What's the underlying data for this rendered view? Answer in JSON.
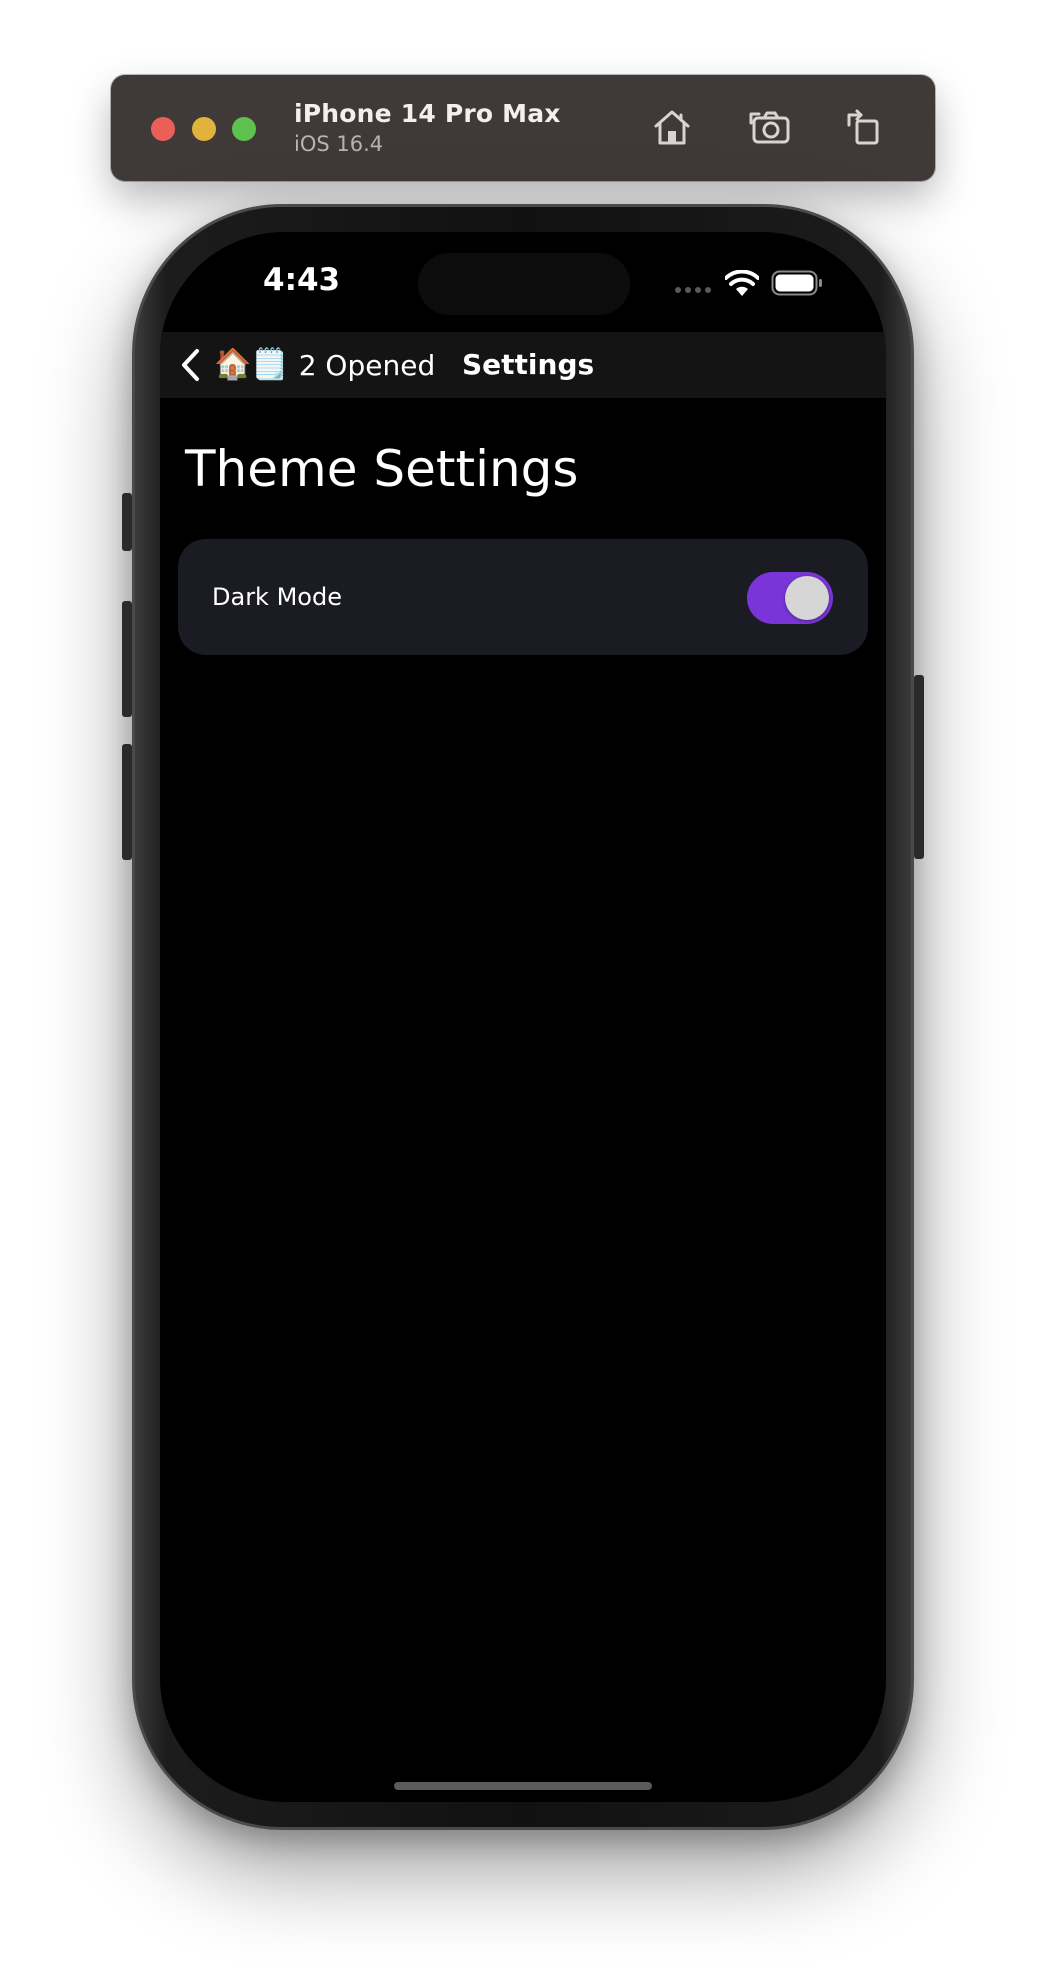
{
  "simulator": {
    "device_name": "iPhone 14 Pro Max",
    "os_version": "iOS 16.4",
    "toolbar_icons": [
      "home-icon",
      "screenshot-camera-icon",
      "rotate-icon"
    ],
    "window_controls": [
      "close",
      "minimize",
      "zoom"
    ]
  },
  "status_bar": {
    "time": "4:43",
    "icons": [
      "cellular-dots-icon",
      "wifi-icon",
      "battery-icon"
    ]
  },
  "nav_bar": {
    "back_emoji": "🏠🗒️",
    "back_label": "2 Opened",
    "title": "Settings"
  },
  "page": {
    "title": "Theme Settings",
    "settings": [
      {
        "label": "Dark Mode",
        "value": true
      }
    ]
  },
  "colors": {
    "toggle_on": "#7a35d8",
    "card_background": "#1b1c23",
    "screen_background": "#000000",
    "toolbar_background": "#3f3a38"
  }
}
